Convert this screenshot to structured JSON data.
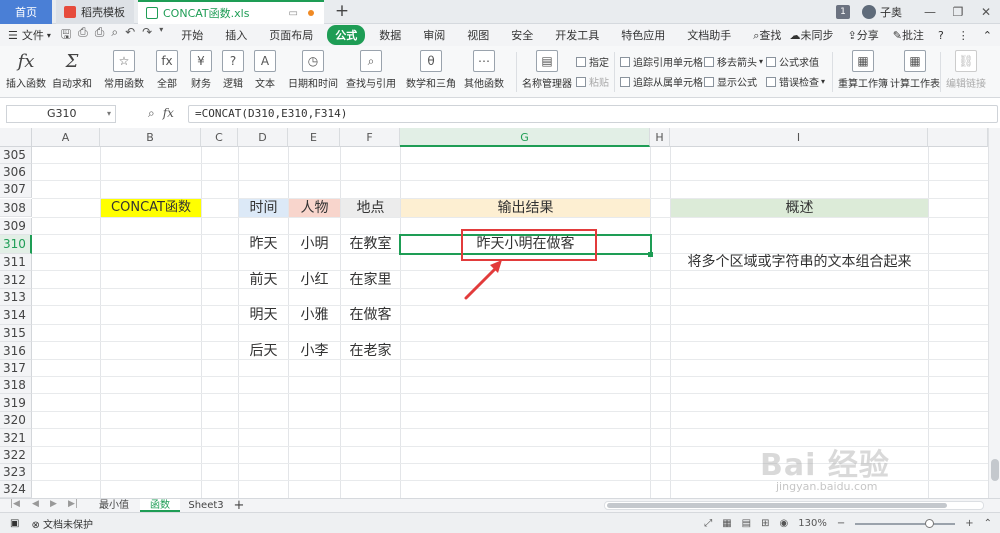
{
  "titlebar": {
    "home_tab": "首页",
    "daoke_tab": "稻壳模板",
    "file_tab": "CONCAT函数.xls",
    "new_tab_symbol": "+",
    "window_count": "1",
    "user_name": "子奥"
  },
  "menubar": {
    "file_menu": "文件",
    "tabs": [
      "开始",
      "插入",
      "页面布局",
      "公式",
      "数据",
      "审阅",
      "视图",
      "安全",
      "开发工具",
      "特色应用",
      "文档助手"
    ],
    "active_tab_index": 3,
    "search": "查找",
    "sync": "未同步",
    "share": "分享",
    "comment": "批注",
    "help": "?"
  },
  "ribbon": {
    "insert_function": "插入函数",
    "autosum": "自动求和",
    "common_functions": "常用函数",
    "all": "全部",
    "finance": "财务",
    "logic": "逻辑",
    "text": "文本",
    "datetime": "日期和时间",
    "lookup": "查找与引用",
    "math": "数学和三角",
    "other_functions": "其他函数",
    "name_manager": "名称管理器",
    "specify": "指定",
    "paste": "粘贴",
    "trace_precedents": "追踪引用单元格",
    "trace_dependents": "追踪从属单元格",
    "remove_arrows": "移去箭头",
    "show_formulas": "显示公式",
    "evaluate_formula": "公式求值",
    "error_checking": "错误检查",
    "recalc_workbook": "重算工作簿",
    "calc_sheet": "计算工作表",
    "edit_links": "编辑链接"
  },
  "formula_bar": {
    "name_box": "G310",
    "fx": "fx",
    "formula": "=CONCAT(D310,E310,F314)"
  },
  "grid": {
    "columns": [
      "A",
      "B",
      "C",
      "D",
      "E",
      "F",
      "G",
      "H",
      "I"
    ],
    "selected_column": "G",
    "rows": [
      "305",
      "306",
      "307",
      "308",
      "309",
      "310",
      "311",
      "312",
      "313",
      "314",
      "315",
      "316",
      "317",
      "318",
      "319",
      "320",
      "321",
      "322",
      "323",
      "324"
    ],
    "selected_row": "310",
    "cells": {
      "b308": "CONCAT函数",
      "d308": "时间",
      "e308": "人物",
      "f308": "地点",
      "g308": "输出结果",
      "i308": "概述",
      "d310": "昨天",
      "e310": "小明",
      "f310": "在教室",
      "g310": "昨天小明在做客",
      "i311": "将多个区域或字符串的文本组合起来",
      "d312": "前天",
      "e312": "小红",
      "f312": "在家里",
      "d314": "明天",
      "e314": "小雅",
      "f314": "在做客",
      "d316": "后天",
      "e316": "小李",
      "f316": "在老家"
    },
    "colors": {
      "b308_fill": "#ffff00",
      "d308_fill": "#dce9f7",
      "e308_fill": "#f8d5cc",
      "f308_fill": "#ececec",
      "g308_fill": "#fdefd2",
      "i308_fill": "#dcebd8",
      "selection": "#1e9d55",
      "annotation": "#e23b3b"
    }
  },
  "sheets": {
    "tabs": [
      "最小值",
      "函数",
      "Sheet3"
    ],
    "active_index": 1,
    "add": "+"
  },
  "statusbar": {
    "protect": "文档未保护",
    "zoom": "130%",
    "zoom_minus": "−",
    "zoom_plus": "+"
  },
  "watermark": {
    "brand": "Bai 经验",
    "url": "jingyan.baidu.com"
  }
}
